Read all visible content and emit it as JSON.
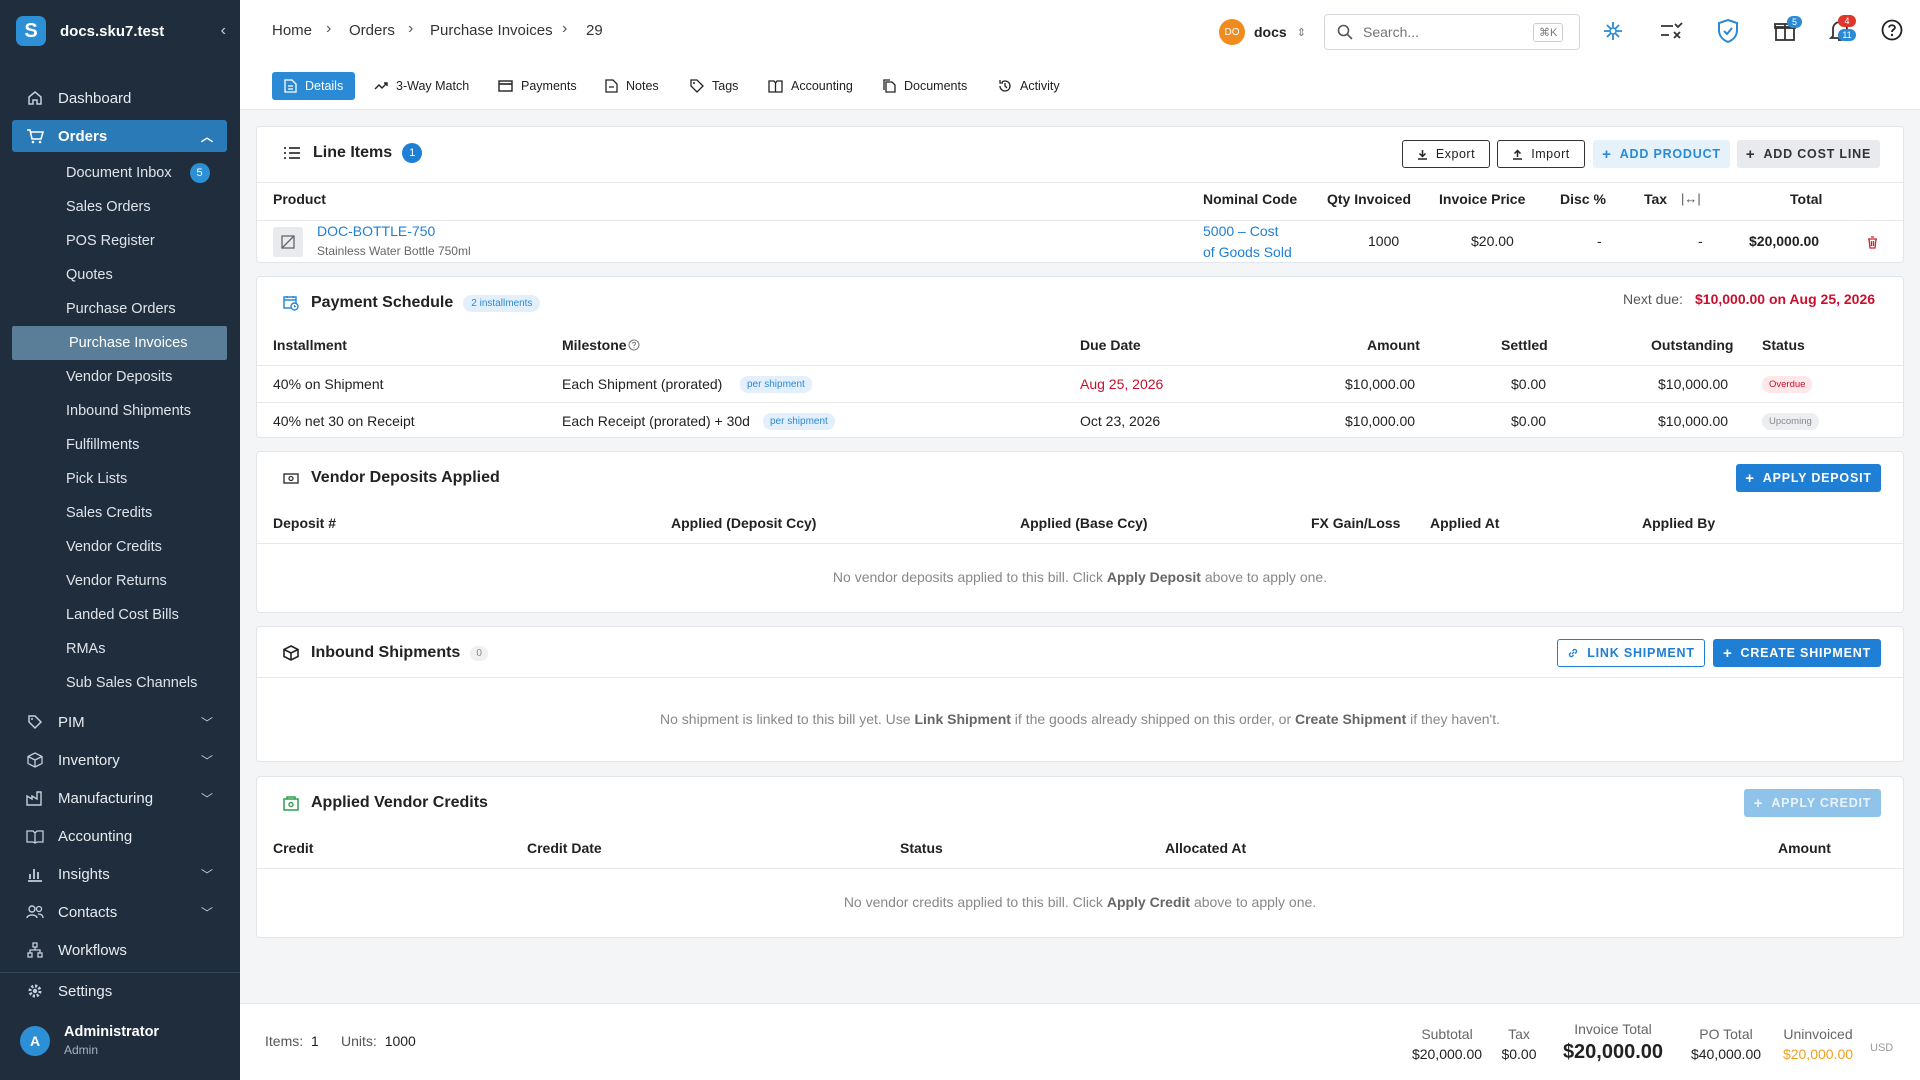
{
  "sidebar": {
    "brand": "docs.sku7.test",
    "nav": {
      "dashboard": "Dashboard",
      "orders": "Orders",
      "pim": "PIM",
      "inventory": "Inventory",
      "manufacturing": "Manufacturing",
      "accounting": "Accounting",
      "insights": "Insights",
      "contacts": "Contacts",
      "workflows": "Workflows",
      "settings": "Settings"
    },
    "orders_sub": [
      "Document Inbox",
      "Sales Orders",
      "POS Register",
      "Quotes",
      "Purchase Orders",
      "Purchase Invoices",
      "Vendor Deposits",
      "Inbound Shipments",
      "Fulfillments",
      "Pick Lists",
      "Sales Credits",
      "Vendor Credits",
      "Vendor Returns",
      "Landed Cost Bills",
      "RMAs",
      "Sub Sales Channels"
    ],
    "document_inbox_count": "5",
    "user": {
      "initial": "A",
      "name": "Administrator",
      "role": "Admin"
    }
  },
  "header": {
    "breadcrumb": [
      "Home",
      "Orders",
      "Purchase Invoices",
      "29"
    ],
    "workspace": {
      "initials": "DO",
      "name": "docs"
    },
    "search": {
      "placeholder": "Search...",
      "shortcut": "⌘K"
    },
    "gift_badge": "5",
    "bell_badge_top": "4",
    "bell_badge_bottom": "11",
    "tabs": [
      "Details",
      "3-Way Match",
      "Payments",
      "Notes",
      "Tags",
      "Accounting",
      "Documents",
      "Activity"
    ]
  },
  "line_items": {
    "title": "Line Items",
    "count": "1",
    "export_label": "Export",
    "import_label": "Import",
    "add_product_label": "ADD PRODUCT",
    "add_cost_line_label": "ADD COST LINE",
    "columns": [
      "Product",
      "Nominal Code",
      "Qty Invoiced",
      "Invoice Price",
      "Disc %",
      "Tax",
      "Total"
    ],
    "rows": [
      {
        "sku": "DOC-BOTTLE-750",
        "name": "Stainless Water Bottle 750ml",
        "nominal_1": "5000 – Cost",
        "nominal_2": "of Goods Sold",
        "qty": "1000",
        "price": "$20.00",
        "disc": "-",
        "tax": "-",
        "total": "$20,000.00"
      }
    ]
  },
  "payment_schedule": {
    "title": "Payment Schedule",
    "installments_badge": "2 installments",
    "next_due_label": "Next due:",
    "next_due_value": "$10,000.00 on Aug 25, 2026",
    "columns": [
      "Installment",
      "Milestone",
      "Due Date",
      "Amount",
      "Settled",
      "Outstanding",
      "Status"
    ],
    "rows": [
      {
        "installment": "40% on Shipment",
        "milestone": "Each Shipment (prorated)",
        "tag": "per shipment",
        "due": "Aug 25, 2026",
        "amount": "$10,000.00",
        "settled": "$0.00",
        "outstanding": "$10,000.00",
        "status": "Overdue"
      },
      {
        "installment": "40% net 30 on Receipt",
        "milestone": "Each Receipt (prorated) + 30d",
        "tag": "per shipment",
        "due": "Oct 23, 2026",
        "amount": "$10,000.00",
        "settled": "$0.00",
        "outstanding": "$10,000.00",
        "status": "Upcoming"
      }
    ]
  },
  "vendor_deposits": {
    "title": "Vendor Deposits Applied",
    "apply_label": "APPLY DEPOSIT",
    "columns": [
      "Deposit #",
      "Applied (Deposit Ccy)",
      "Applied (Base Ccy)",
      "FX Gain/Loss",
      "Applied At",
      "Applied By"
    ],
    "empty_pre": "No vendor deposits applied to this bill. Click ",
    "empty_bold": "Apply Deposit",
    "empty_post": " above to apply one."
  },
  "inbound_shipments": {
    "title": "Inbound Shipments",
    "count": "0",
    "link_label": "LINK SHIPMENT",
    "create_label": "CREATE SHIPMENT",
    "empty_1": "No shipment is linked to this bill yet. Use ",
    "empty_b1": "Link Shipment",
    "empty_2": " if the goods already shipped on this order, or ",
    "empty_b2": "Create Shipment",
    "empty_3": " if they haven't."
  },
  "vendor_credits": {
    "title": "Applied Vendor Credits",
    "apply_label": "APPLY CREDIT",
    "columns": [
      "Credit",
      "Credit Date",
      "Status",
      "Allocated At",
      "Amount"
    ],
    "empty_pre": "No vendor credits applied to this bill. Click ",
    "empty_bold": "Apply Credit",
    "empty_post": " above to apply one."
  },
  "footer": {
    "items_label": "Items:",
    "items_value": "1",
    "units_label": "Units:",
    "units_value": "1000",
    "subtotal_label": "Subtotal",
    "subtotal_value": "$20,000.00",
    "tax_label": "Tax",
    "tax_value": "$0.00",
    "invoice_total_label": "Invoice Total",
    "invoice_total_value": "$20,000.00",
    "po_total_label": "PO Total",
    "po_total_value": "$40,000.00",
    "uninvoiced_label": "Uninvoiced",
    "uninvoiced_value": "$20,000.00",
    "currency": "USD"
  },
  "colors": {
    "accent": "#2a8ad6",
    "sidebar": "#1f2d3d",
    "danger": "#c8102e",
    "warning": "#f0a020"
  }
}
